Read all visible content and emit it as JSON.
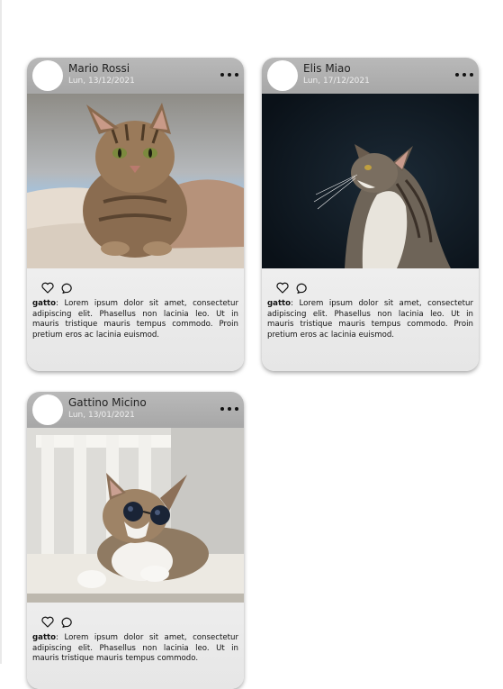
{
  "posts": [
    {
      "author": "Mario Rossi",
      "date": "Lun, 13/12/2021",
      "photo": "tabby-cat-on-bed",
      "caption_user": "gatto",
      "caption_text": ": Lorem ipsum dolor sit amet, consectetur adipiscing elit. Phasellus non lacinia leo. Ut in mauris tristique mauris tempus commodo. Proin pretium eros ac lacinia euismod."
    },
    {
      "author": "Elis Miao",
      "date": "Lun, 17/12/2021",
      "photo": "cat-looking-up-dark-background",
      "caption_user": "gatto",
      "caption_text": ": Lorem ipsum dolor sit amet, consectetur adipiscing elit. Phasellus non lacinia leo. Ut in mauris tristique mauris tempus commodo. Proin pretium eros ac lacinia euismod."
    },
    {
      "author": "Gattino Micino",
      "date": "Lun, 13/01/2021",
      "photo": "cat-with-sunglasses-on-bench",
      "caption_user": "gatto",
      "caption_text": ": Lorem ipsum dolor sit amet, consectetur adipiscing elit. Phasellus non lacinia leo. Ut in mauris tristique mauris tempus commodo."
    }
  ],
  "icons": {
    "more": "more-options-icon",
    "like": "heart-icon",
    "comment": "comment-icon"
  },
  "colors": {
    "header": "#aeaeae",
    "card_bottom": "#e6e6e6",
    "date_text": "#eeeeee"
  }
}
